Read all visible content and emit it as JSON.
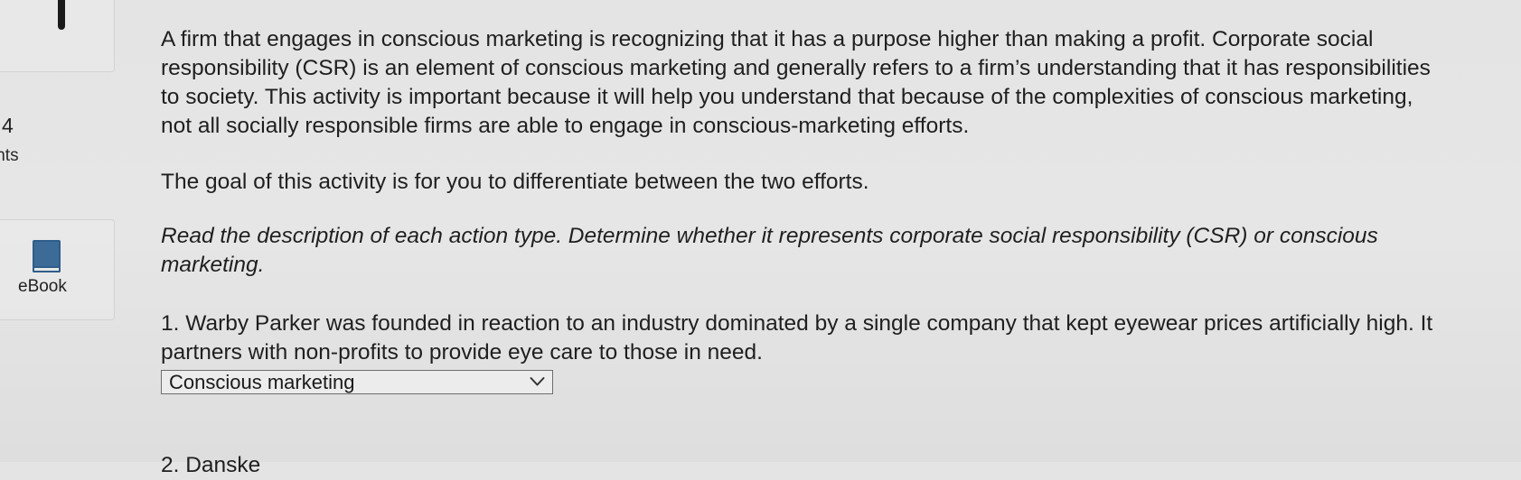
{
  "sidebar": {
    "points_value": "4",
    "points_label": "ints",
    "ebook_label": "eBook",
    "ebook_icon": "book-icon"
  },
  "content": {
    "intro": "A firm that engages in conscious marketing is recognizing that it has a purpose higher than making a profit. Corporate social responsibility (CSR) is an element of conscious marketing and generally refers to a firm’s understanding that it has responsibilities to society. This activity is important because it will help you understand that because of the complexities of conscious marketing, not all socially responsible firms are able to engage in conscious-marketing efforts.",
    "goal": "The goal of this activity is for you to differentiate between the two efforts.",
    "instructions": "Read the description of each action type. Determine whether it represents corporate social responsibility (CSR) or conscious marketing."
  },
  "questions": [
    {
      "text": "1. Warby Parker was founded in reaction to an industry dominated by a single company that kept eyewear prices artificially high. It partners with non-profits to provide eye care to those in need.",
      "selected": "Conscious marketing",
      "chevron_icon": "chevron-down-icon"
    }
  ],
  "cut_off_text": "2. Danske"
}
